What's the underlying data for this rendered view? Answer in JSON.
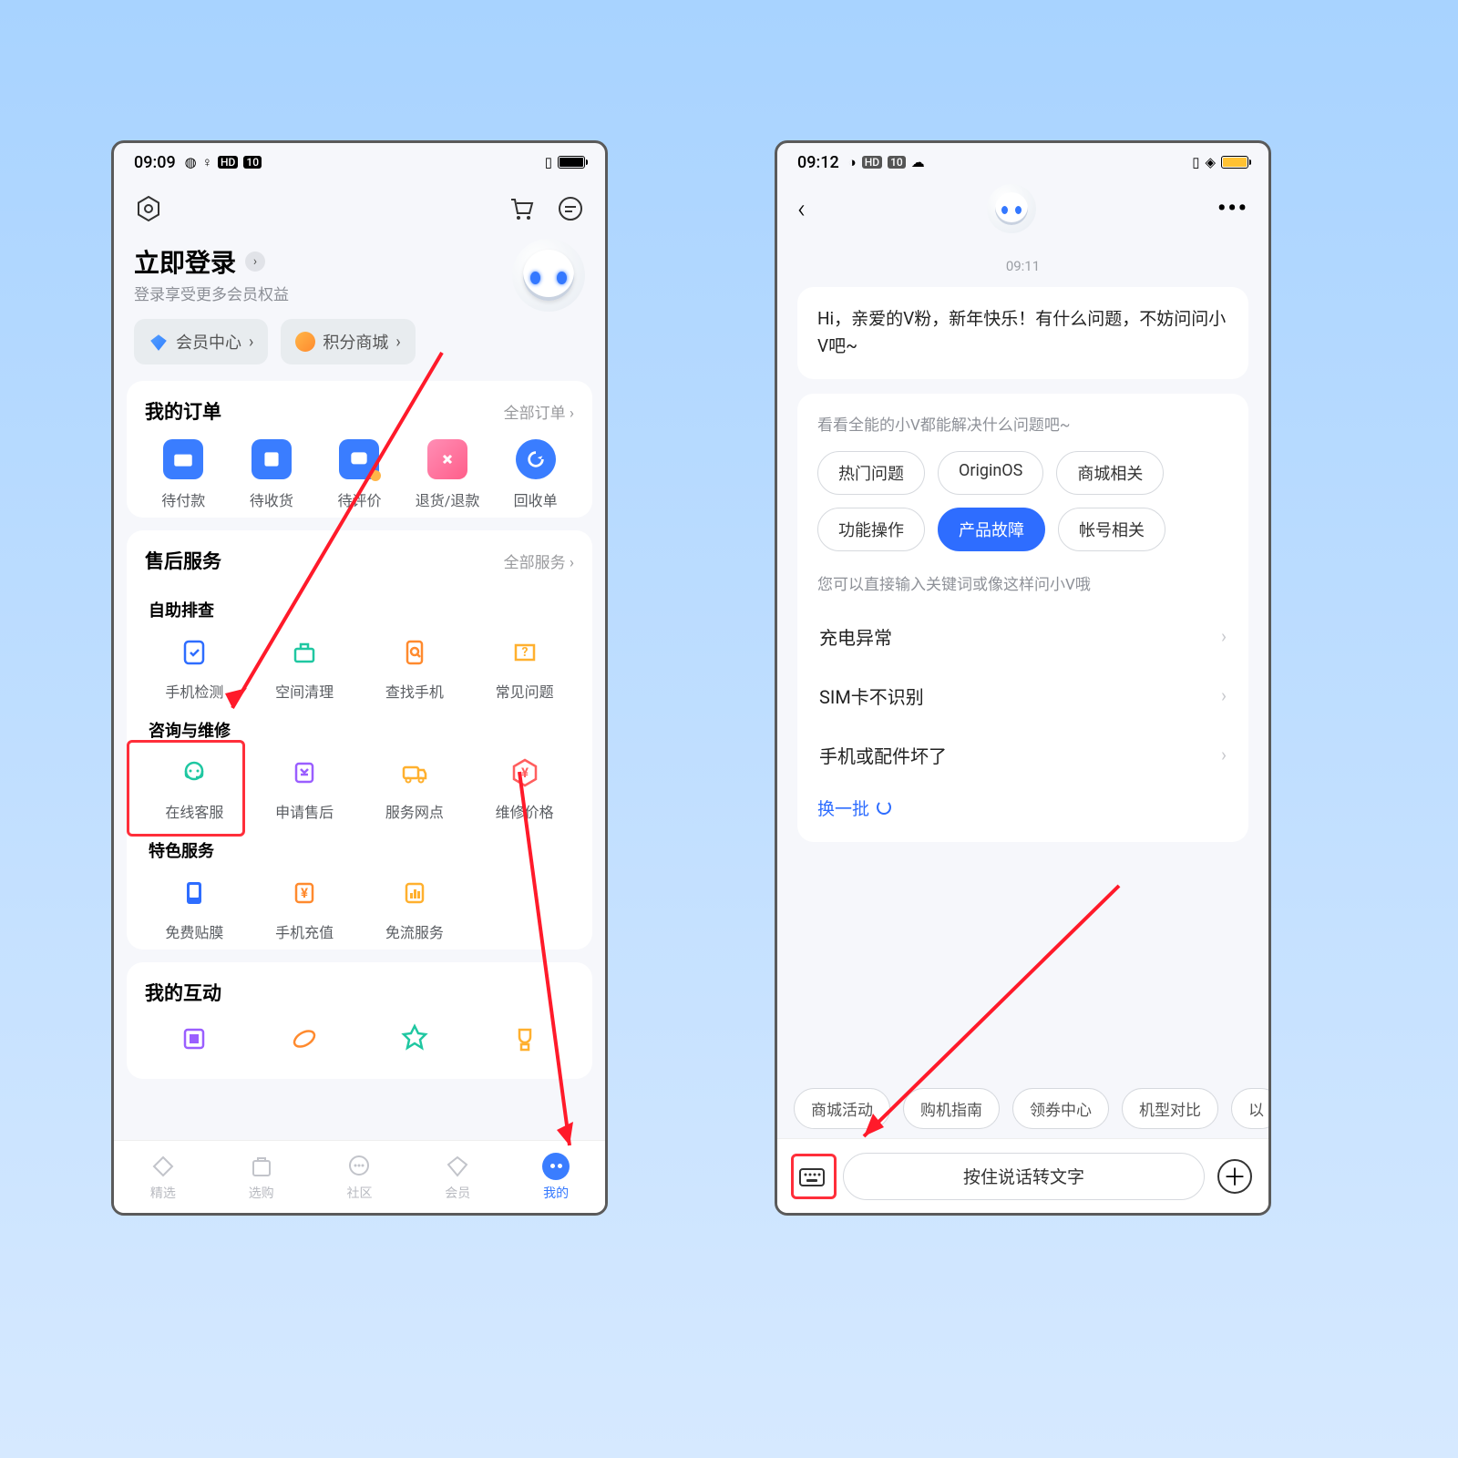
{
  "left": {
    "status_time": "09:09",
    "login_title": "立即登录",
    "login_sub": "登录享受更多会员权益",
    "chip_member": "会员中心",
    "chip_points": "积分商城",
    "orders_title": "我的订单",
    "orders_more": "全部订单 ›",
    "orders": [
      "待付款",
      "待收货",
      "待评价",
      "退货/退款",
      "回收单"
    ],
    "service_title": "售后服务",
    "service_more": "全部服务 ›",
    "svc_self": "自助排查",
    "svc_self_items": [
      "手机检测",
      "空间清理",
      "查找手机",
      "常见问题"
    ],
    "svc_consult": "咨询与维修",
    "svc_consult_items": [
      "在线客服",
      "申请售后",
      "服务网点",
      "维修价格"
    ],
    "svc_special": "特色服务",
    "svc_special_items": [
      "免费贴膜",
      "手机充值",
      "免流服务"
    ],
    "interact_title": "我的互动",
    "nav": [
      "精选",
      "选购",
      "社区",
      "会员",
      "我的"
    ]
  },
  "right": {
    "status_time": "09:12",
    "msg_time": "09:11",
    "greeting": "Hi，亲爱的V粉，新年快乐！有什么问题，不妨问问小V吧~",
    "hint1": "看看全能的小V都能解决什么问题吧~",
    "tags": [
      "热门问题",
      "OriginOS",
      "商城相关",
      "功能操作",
      "产品故障",
      "帐号相关"
    ],
    "tag_selected_index": 4,
    "hint2": "您可以直接输入关键词或像这样问小V哦",
    "rows": [
      "充电异常",
      "SIM卡不识别",
      "手机或配件坏了"
    ],
    "refresh": "换一批",
    "quick": [
      "商城活动",
      "购机指南",
      "领券中心",
      "机型对比",
      "以"
    ],
    "input_placeholder": "按住说话转文字"
  }
}
